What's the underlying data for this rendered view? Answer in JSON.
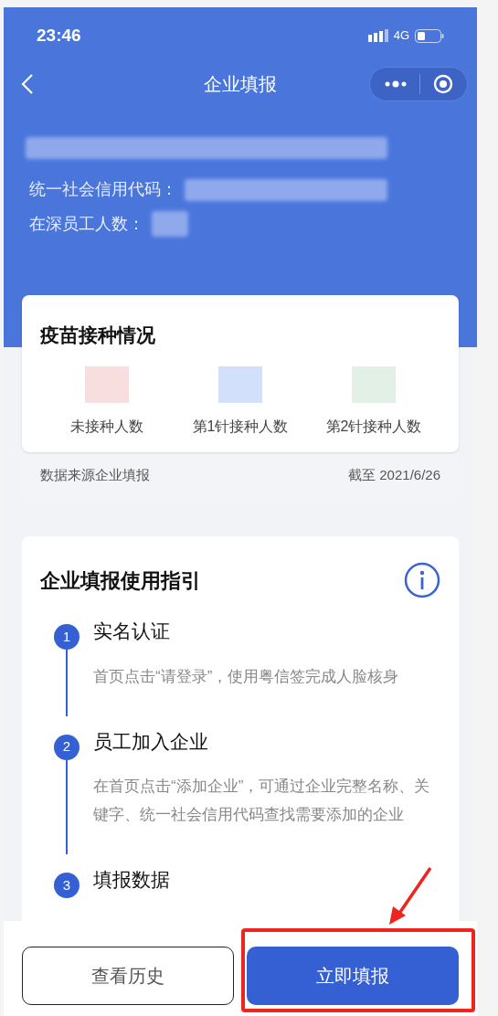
{
  "status_bar": {
    "time": "23:46",
    "network": "4G"
  },
  "nav": {
    "title": "企业填报"
  },
  "company": {
    "fields": [
      {
        "label": "统一社会信用代码："
      },
      {
        "label": "在深员工人数："
      }
    ]
  },
  "vaccination": {
    "title": "疫苗接种情况",
    "stats": [
      {
        "label": "未接种人数",
        "color": "#f8dede"
      },
      {
        "label": "第1针接种人数",
        "color": "#d3e0fb"
      },
      {
        "label": "第2针接种人数",
        "color": "#e2f0e5"
      }
    ],
    "source": "数据来源企业填报",
    "as_of": "截至 2021/6/26"
  },
  "guide": {
    "title": "企业填报使用指引",
    "steps": [
      {
        "number": "1",
        "title": "实名认证",
        "text": "首页点击“请登录”，使用粤信签完成人脸核身"
      },
      {
        "number": "2",
        "title": "员工加入企业",
        "text": "在首页点击“添加企业”，可通过企业完整名称、关键字、统一社会信用代码查找需要添加的企业"
      },
      {
        "number": "3",
        "title": "填报数据"
      }
    ]
  },
  "actions": [
    {
      "label": "查看历史",
      "kind": "secondary",
      "highlighted": false
    },
    {
      "label": "立即填报",
      "kind": "primary",
      "highlighted": true
    }
  ]
}
